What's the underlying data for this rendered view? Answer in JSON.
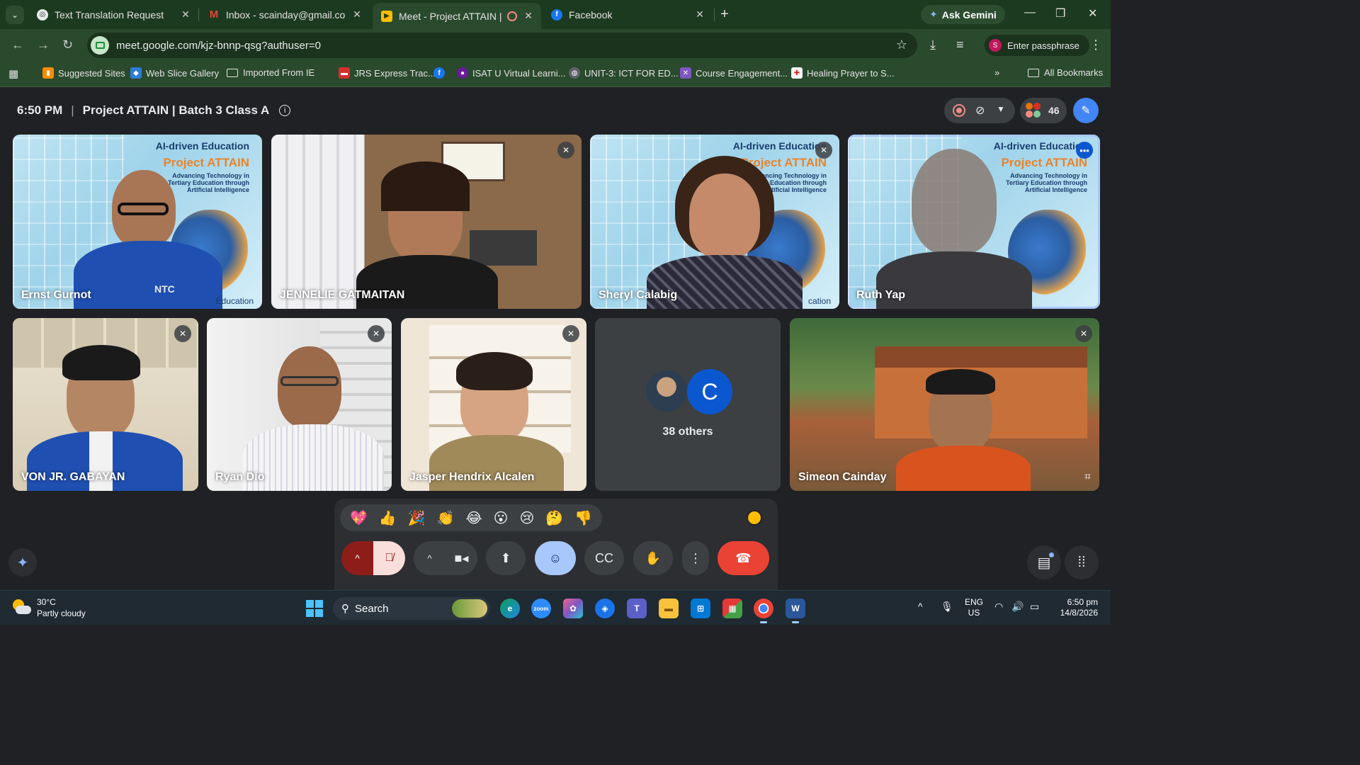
{
  "browser": {
    "tabs": [
      {
        "title": "Text Translation Request"
      },
      {
        "title": "Inbox - scainday@gmail.com - "
      },
      {
        "title": "Meet - Project ATTAIN | Bat"
      },
      {
        "title": "Facebook"
      }
    ],
    "gemini_button": "Ask Gemini",
    "url": "meet.google.com/kjz-bnnp-qsg?authuser=0",
    "profile_initial": "S",
    "profile_label": "Enter passphrase",
    "bookmarks": [
      "Suggested Sites",
      "Web Slice Gallery",
      "Imported From IE",
      "JRS Express Trac...",
      "ISAT U Virtual Learni...",
      "UNIT-3: ICT FOR ED...",
      "Course Engagement...",
      "Healing Prayer to S...",
      "All Bookmarks"
    ]
  },
  "meet": {
    "time": "6:50 PM",
    "separator": "|",
    "title": "Project ATTAIN | Batch 3 Class A",
    "participant_count": "46",
    "banner": {
      "line1": "AI-driven Education",
      "line2": "Project ATTAIN",
      "line3a": "Advancing Technology in",
      "line3b": "Tertiary Education through",
      "line3c": "Artificial Intelligence",
      "footer": "Education",
      "footer_cut": "cation",
      "shirt": "NTC"
    },
    "participants": [
      {
        "name": "Ernst Gurnot"
      },
      {
        "name": "JENNELIE GATMAITAN"
      },
      {
        "name": "Sheryl Calabig"
      },
      {
        "name": "Ruth Yap"
      },
      {
        "name": "VON JR. GABAYAN"
      },
      {
        "name": "Ryan Dio"
      },
      {
        "name": "Jasper Hendrix Alcalen"
      },
      {
        "name": "Simeon Cainday"
      }
    ],
    "others": {
      "avatar_letter": "C",
      "label": "38 others"
    },
    "reactions": [
      "💖",
      "👍",
      "🎉",
      "👏",
      "😂",
      "😮",
      "😢",
      "🤔",
      "👎"
    ]
  },
  "taskbar": {
    "temp": "30°C",
    "condition": "Partly cloudy",
    "search": "Search",
    "lang1": "ENG",
    "lang2": "US",
    "time": "6:50 pm",
    "date": "14/8/2026"
  },
  "colors": {
    "tab_strip": "#1c3a1f",
    "toolbar": "#2a4a2d",
    "meet_bg": "#202124",
    "end_call": "#ea4335",
    "accent_blue": "#a8c7fa"
  }
}
